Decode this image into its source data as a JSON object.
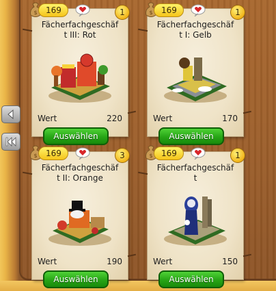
{
  "cards": [
    {
      "price": "169",
      "count": "1",
      "title": "Fächerfachgeschäf\nt III: Rot",
      "value_label": "Wert",
      "value": "220",
      "button": "Auswählen"
    },
    {
      "price": "169",
      "count": "1",
      "title": "Fächerfachgeschäf\nt I: Gelb",
      "value_label": "Wert",
      "value": "170",
      "button": "Auswählen"
    },
    {
      "price": "169",
      "count": "3",
      "title": "Fächerfachgeschäf\nt II: Orange",
      "value_label": "Wert",
      "value": "190",
      "button": "Auswählen"
    },
    {
      "price": "169",
      "count": "1",
      "title": "Fächerfachgeschäf\nt",
      "value_label": "Wert",
      "value": "150",
      "button": "Auswählen"
    }
  ],
  "nav": {
    "prev_icon": "arrow-left-icon",
    "first_icon": "double-arrow-left-icon"
  },
  "colors": {
    "button_green": "#27a516",
    "badge_gold": "#f2b51a",
    "card_bg": "#efe3c7"
  }
}
